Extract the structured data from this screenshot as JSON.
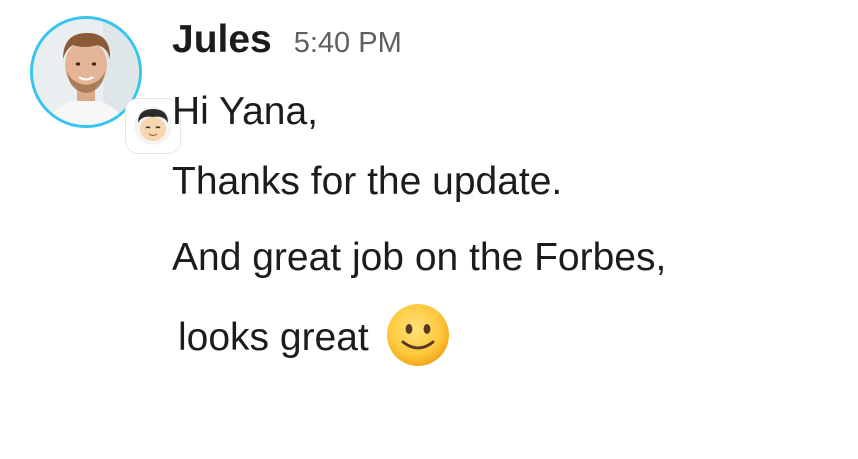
{
  "message": {
    "sender": "Jules",
    "timestamp": "5:40 PM",
    "lines": [
      "Hi Yana,",
      "Thanks for the update.",
      "And great job on the Forbes,",
      "looks great"
    ],
    "emoji": "slightly-smiling-face"
  },
  "colors": {
    "avatar_ring": "#36c5f0",
    "text": "#1d1c1d",
    "timestamp": "#616061"
  },
  "icons": {
    "avatar": "user-avatar-photo",
    "secondary_avatar": "cartoon-avatar-icon",
    "emoji": "slightly-smiling-face-icon"
  }
}
